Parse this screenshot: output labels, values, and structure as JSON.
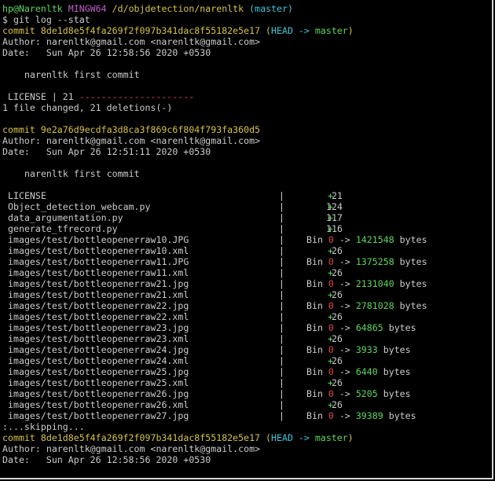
{
  "prompt": {
    "user_host": "hp@Narenltk",
    "shell": "MINGW64",
    "path": "/d/objdetection/narenltk",
    "branch": "(master)",
    "command": "$ git log --stat"
  },
  "commit1": {
    "label": "commit 8de1d8e5f4fa269f2f097b341dac8f55182e5e17",
    "head_open": "(",
    "head": "HEAD -> ",
    "branch": "master",
    "head_close": ")",
    "author": "Author: narenltk@gmail.com <narenltk@gmail.com>",
    "date": "Date:   Sun Apr 26 12:58:56 2020 +0530",
    "message": "narenltk first commit",
    "stat_file": "LICENSE | 21 ",
    "stat_bar": "---------------------",
    "summary": "1 file changed, 21 deletions(-)"
  },
  "commit2": {
    "label": "commit 9e2a76d9ecdfa3d8ca3f869c6f804f793fa360d5",
    "author": "Author: narenltk@gmail.com <narenltk@gmail.com>",
    "date": "Date:   Sun Apr 26 12:51:11 2020 +0530",
    "message": "narenltk first commit"
  },
  "stats": [
    {
      "path": "LICENSE",
      "count": "21",
      "plus": "+"
    },
    {
      "path": "Object_detection_webcam.py",
      "count": "124",
      "plus": "+"
    },
    {
      "path": "data_argumentation.py",
      "count": "117",
      "plus": "+"
    },
    {
      "path": "generate_tfrecord.py",
      "count": "116",
      "plus": "+"
    },
    {
      "path": "images/test/bottleopenerraw10.JPG",
      "bin": "Bin ",
      "zero": "0",
      "arrow": " -> ",
      "size": "1421548",
      "unit": " bytes"
    },
    {
      "path": "images/test/bottleopenerraw10.xml",
      "count": "26",
      "plus": "+"
    },
    {
      "path": "images/test/bottleopenerraw11.JPG",
      "bin": "Bin ",
      "zero": "0",
      "arrow": " -> ",
      "size": "1375258",
      "unit": " bytes"
    },
    {
      "path": "images/test/bottleopenerraw11.xml",
      "count": "26",
      "plus": "+"
    },
    {
      "path": "images/test/bottleopenerraw21.jpg",
      "bin": "Bin ",
      "zero": "0",
      "arrow": " -> ",
      "size": "2131040",
      "unit": " bytes"
    },
    {
      "path": "images/test/bottleopenerraw21.xml",
      "count": "26",
      "plus": "+"
    },
    {
      "path": "images/test/bottleopenerraw22.jpg",
      "bin": "Bin ",
      "zero": "0",
      "arrow": " -> ",
      "size": "2781028",
      "unit": " bytes"
    },
    {
      "path": "images/test/bottleopenerraw22.xml",
      "count": "26",
      "plus": "+"
    },
    {
      "path": "images/test/bottleopenerraw23.jpg",
      "bin": "Bin ",
      "zero": "0",
      "arrow": " -> ",
      "size": "64865",
      "unit": " bytes"
    },
    {
      "path": "images/test/bottleopenerraw23.xml",
      "count": "26",
      "plus": "+"
    },
    {
      "path": "images/test/bottleopenerraw24.jpg",
      "bin": "Bin ",
      "zero": "0",
      "arrow": " -> ",
      "size": "3933",
      "unit": " bytes"
    },
    {
      "path": "images/test/bottleopenerraw24.xml",
      "count": "26",
      "plus": "+"
    },
    {
      "path": "images/test/bottleopenerraw25.jpg",
      "bin": "Bin ",
      "zero": "0",
      "arrow": " -> ",
      "size": "6440",
      "unit": " bytes"
    },
    {
      "path": "images/test/bottleopenerraw25.xml",
      "count": "26",
      "plus": "+"
    },
    {
      "path": "images/test/bottleopenerraw26.jpg",
      "bin": "Bin ",
      "zero": "0",
      "arrow": " -> ",
      "size": "5205",
      "unit": " bytes"
    },
    {
      "path": "images/test/bottleopenerraw26.xml",
      "count": "26",
      "plus": "+"
    },
    {
      "path": "images/test/bottleopenerraw27.jpg",
      "bin": "Bin ",
      "zero": "0",
      "arrow": " -> ",
      "size": "39389",
      "unit": " bytes"
    }
  ],
  "stat_separator": "|",
  "pager": ":...skipping...",
  "commit3": {
    "label": "commit 8de1d8e5f4fa269f2f097b341dac8f55182e5e17",
    "head_open": "(",
    "head": "HEAD -> ",
    "branch": "master",
    "head_close": ")",
    "author": "Author: narenltk@gmail.com <narenltk@gmail.com>",
    "date": "Date:   Sun Apr 26 12:58:56 2020 +0530"
  },
  "colors": {
    "background": "#000000",
    "text": "#cccccc",
    "green": "#5fd75f",
    "magenta": "#c05fc5",
    "yellow": "#d7c34a",
    "cyan": "#3fc7d7",
    "red": "#e54848"
  }
}
